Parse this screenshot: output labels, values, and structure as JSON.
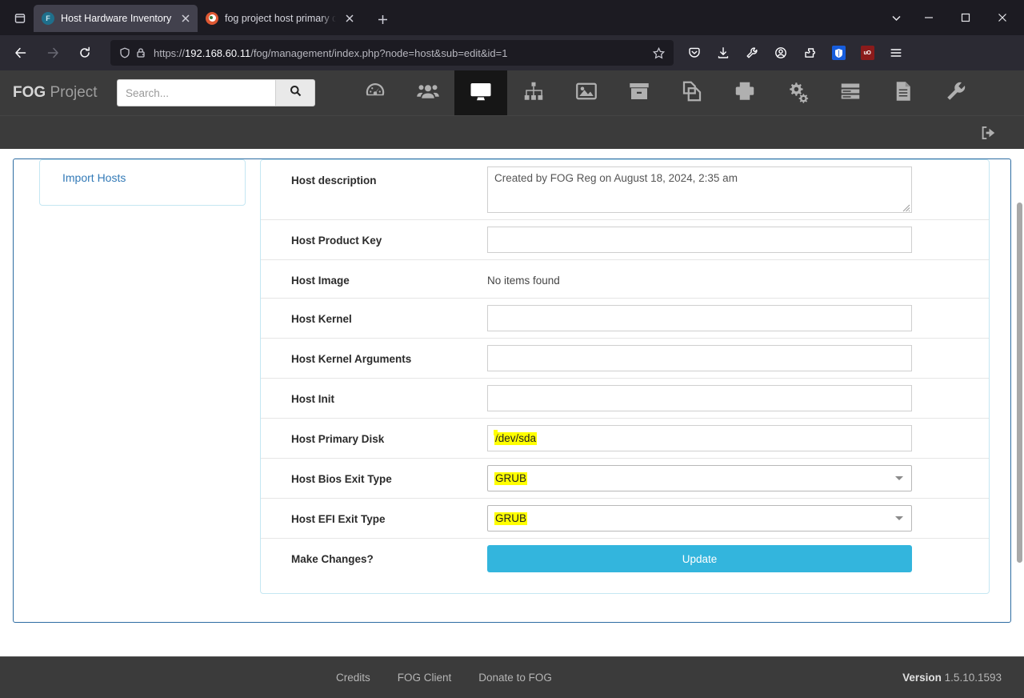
{
  "browser": {
    "tabs": [
      {
        "title": "Host Hardware Inventory",
        "favicon": "fog-f-icon",
        "active": true
      },
      {
        "title": "fog project host primary disk ub",
        "favicon": "duckduckgo-icon",
        "active": false
      }
    ],
    "tab_list_icon": "tab-list-icon",
    "new_tab_icon": "plus-icon",
    "close_icon": "close-icon",
    "nav": {
      "back_icon": "back-arrow-icon",
      "forward_icon": "forward-arrow-icon",
      "reload_icon": "reload-icon"
    },
    "url": {
      "full": "https://192.168.60.11/fog/management/index.php?node=host&sub=edit&id=1",
      "scheme": "https://",
      "host": "192.168.60.11",
      "path": "/fog/management/index.php?node=host&sub=edit&id=1",
      "shield_icon": "shield-icon",
      "lock_warning_icon": "lock-warning-icon",
      "bookmark_icon": "star-icon"
    },
    "toolbar_icons": [
      "pocket-save-icon",
      "downloads-icon",
      "wrench-icon",
      "account-icon",
      "extensions-icon",
      "bitwarden-icon",
      "ublock-origin-icon",
      "app-menu-icon"
    ],
    "window_controls": {
      "chevron_icon": "chevron-down-icon",
      "minimize_icon": "minimize-icon",
      "maximize_icon": "maximize-icon",
      "close_icon": "window-close-icon"
    }
  },
  "fog": {
    "brand_bold": "FOG",
    "brand_rest": " Project",
    "search": {
      "placeholder": "Search...",
      "value": "",
      "button_icon": "search-icon"
    },
    "nav_items": [
      {
        "name": "dashboard",
        "icon": "gauge-icon",
        "active": false
      },
      {
        "name": "users",
        "icon": "users-icon",
        "active": false
      },
      {
        "name": "hosts",
        "icon": "desktop-icon",
        "active": true
      },
      {
        "name": "groups",
        "icon": "sitemap-icon",
        "active": false
      },
      {
        "name": "images",
        "icon": "picture-icon",
        "active": false
      },
      {
        "name": "storage",
        "icon": "archive-box-icon",
        "active": false
      },
      {
        "name": "snapins",
        "icon": "copy-files-icon",
        "active": false
      },
      {
        "name": "printers",
        "icon": "printer-icon",
        "active": false
      },
      {
        "name": "services",
        "icon": "gears-icon",
        "active": false
      },
      {
        "name": "tasks",
        "icon": "task-list-icon",
        "active": false
      },
      {
        "name": "reports",
        "icon": "document-icon",
        "active": false
      },
      {
        "name": "fog-settings",
        "icon": "wrench-icon",
        "active": false
      }
    ],
    "logout_icon": "sign-out-icon",
    "sidebar": {
      "items": [
        {
          "label": "Import Hosts"
        }
      ]
    },
    "form": {
      "rows": [
        {
          "label": "Host description",
          "type": "textarea",
          "value": "Created by FOG Reg on August 18, 2024, 2:35 am",
          "highlighted": false
        },
        {
          "label": "Host Product Key",
          "type": "text",
          "value": "",
          "highlighted": false
        },
        {
          "label": "Host Image",
          "type": "static",
          "value": "No items found",
          "highlighted": false
        },
        {
          "label": "Host Kernel",
          "type": "text",
          "value": "",
          "highlighted": false
        },
        {
          "label": "Host Kernel Arguments",
          "type": "text",
          "value": "",
          "highlighted": false
        },
        {
          "label": "Host Init",
          "type": "text",
          "value": "",
          "highlighted": false
        },
        {
          "label": "Host Primary Disk",
          "type": "text-highlight",
          "value": "/dev/sda",
          "highlighted": true
        },
        {
          "label": "Host Bios Exit Type",
          "type": "select",
          "value": "GRUB",
          "highlighted": true
        },
        {
          "label": "Host EFI Exit Type",
          "type": "select",
          "value": "GRUB",
          "highlighted": true
        },
        {
          "label": "Make Changes?",
          "type": "button",
          "value": "Update",
          "highlighted": false
        }
      ],
      "submit_label": "Update",
      "accent_color": "#33b5dd",
      "highlight_color": "#ffff00"
    },
    "footer": {
      "links": [
        "Credits",
        "FOG Client",
        "Donate to FOG"
      ],
      "version_label": "Version",
      "version_number": "1.5.10.1593"
    }
  }
}
